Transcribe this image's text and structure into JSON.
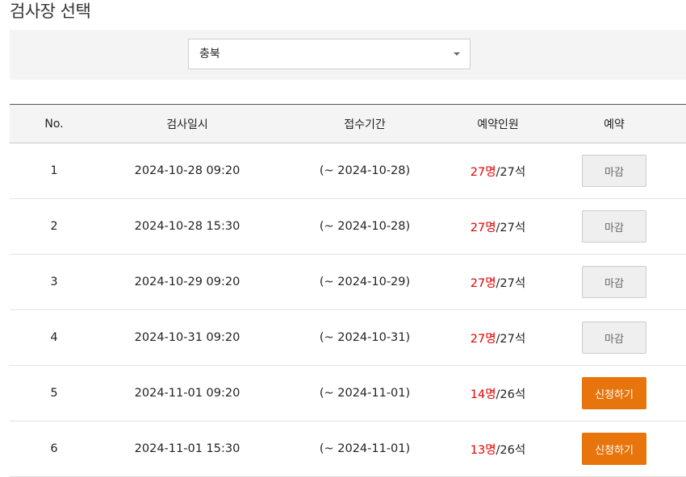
{
  "page": {
    "title": "검사장 선택"
  },
  "filter": {
    "region_value": "충북"
  },
  "table": {
    "columns": [
      "No.",
      "검사일시",
      "접수기간",
      "예약인원",
      "예약"
    ],
    "rows": [
      {
        "no": "1",
        "datetime": "2024-10-28 09:20",
        "period": "(~ 2024-10-28)",
        "reserved": "27명",
        "capacity": "/27석",
        "action": "마감",
        "status": "closed"
      },
      {
        "no": "2",
        "datetime": "2024-10-28 15:30",
        "period": "(~ 2024-10-28)",
        "reserved": "27명",
        "capacity": "/27석",
        "action": "마감",
        "status": "closed"
      },
      {
        "no": "3",
        "datetime": "2024-10-29 09:20",
        "period": "(~ 2024-10-29)",
        "reserved": "27명",
        "capacity": "/27석",
        "action": "마감",
        "status": "closed"
      },
      {
        "no": "4",
        "datetime": "2024-10-31 09:20",
        "period": "(~ 2024-10-31)",
        "reserved": "27명",
        "capacity": "/27석",
        "action": "마감",
        "status": "closed"
      },
      {
        "no": "5",
        "datetime": "2024-11-01 09:20",
        "period": "(~ 2024-11-01)",
        "reserved": "14명",
        "capacity": "/26석",
        "action": "신청하기",
        "status": "apply"
      },
      {
        "no": "6",
        "datetime": "2024-11-01 15:30",
        "period": "(~ 2024-11-01)",
        "reserved": "13명",
        "capacity": "/26석",
        "action": "신청하기",
        "status": "apply"
      }
    ]
  },
  "colors": {
    "accent_button": "#e8740c",
    "reserved_count": "#e30000",
    "closed_button_bg": "#efefef",
    "header_bg": "#f4f4f4"
  },
  "icons": {
    "select_caret": "caret-down-icon"
  }
}
